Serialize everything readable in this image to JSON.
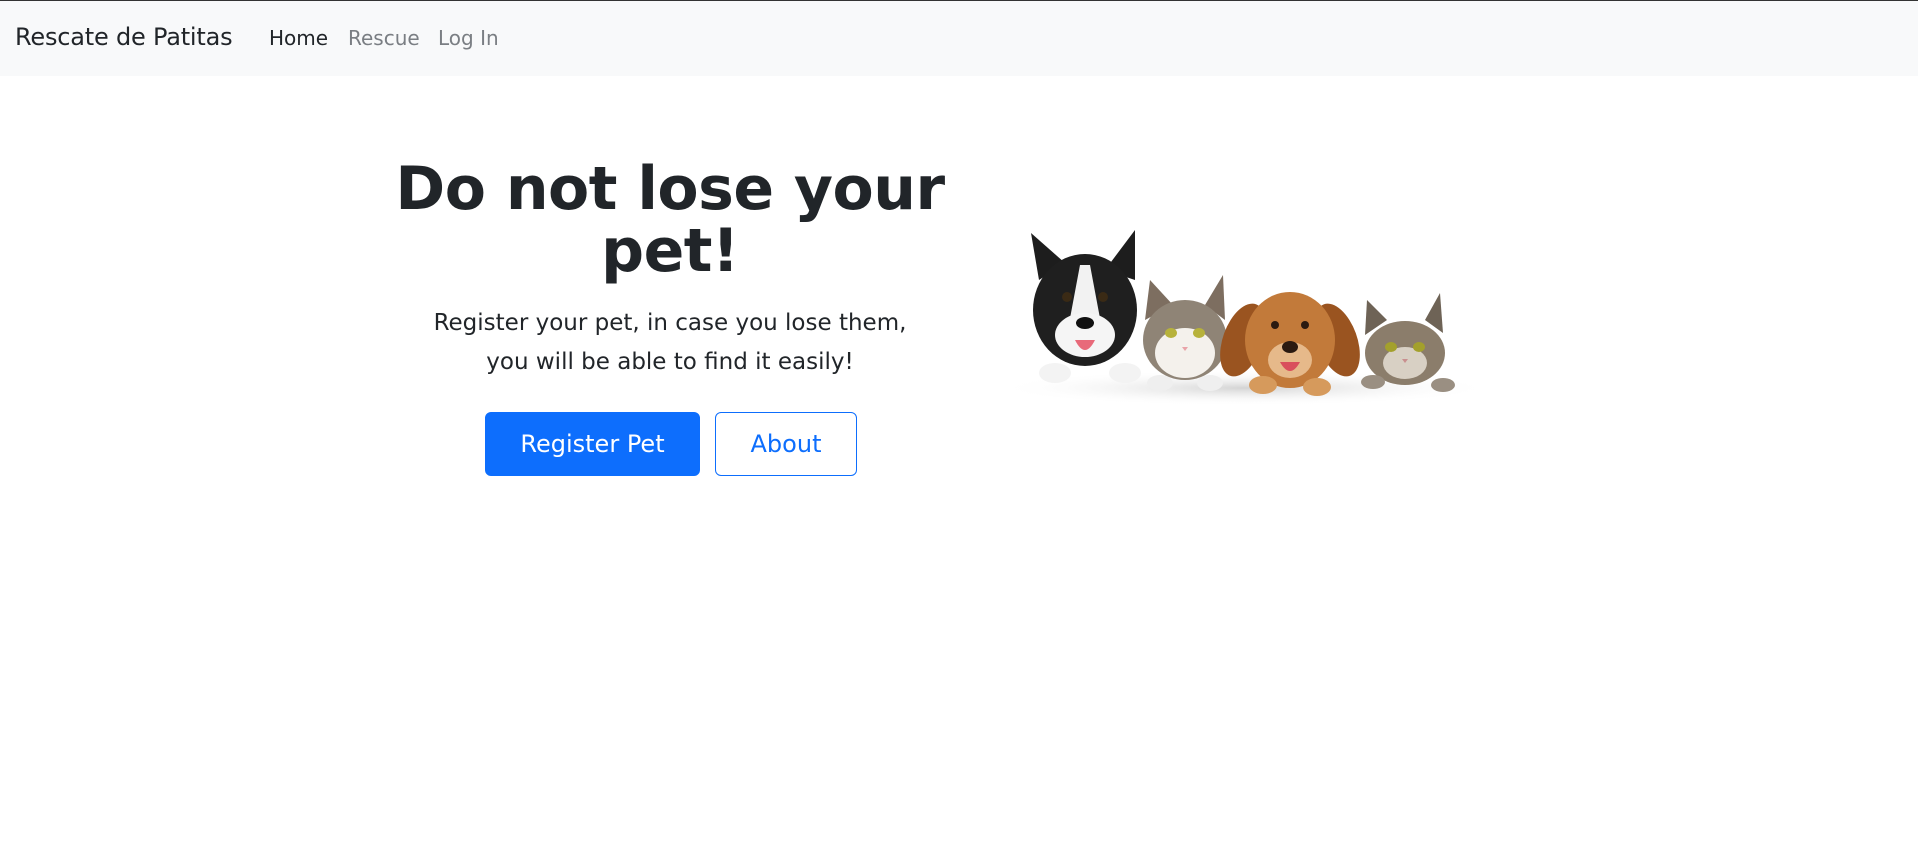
{
  "navbar": {
    "brand": "Rescate de Patitas",
    "links": [
      {
        "label": "Home",
        "active": true
      },
      {
        "label": "Rescue",
        "active": false
      },
      {
        "label": "Log In",
        "active": false
      }
    ]
  },
  "hero": {
    "title": "Do not lose your pet!",
    "subtitle_line1": "Register your pet, in case you lose them,",
    "subtitle_line2": "you will be able to find it easily!",
    "primary_button": "Register Pet",
    "secondary_button": "About"
  },
  "image": {
    "icon": "pets-peeking-over-edge-image",
    "animals": [
      "dog",
      "cat",
      "dog",
      "cat"
    ]
  },
  "colors": {
    "primary": "#0d6efd",
    "navbar_bg": "#f8f9fa",
    "text": "#212529"
  }
}
